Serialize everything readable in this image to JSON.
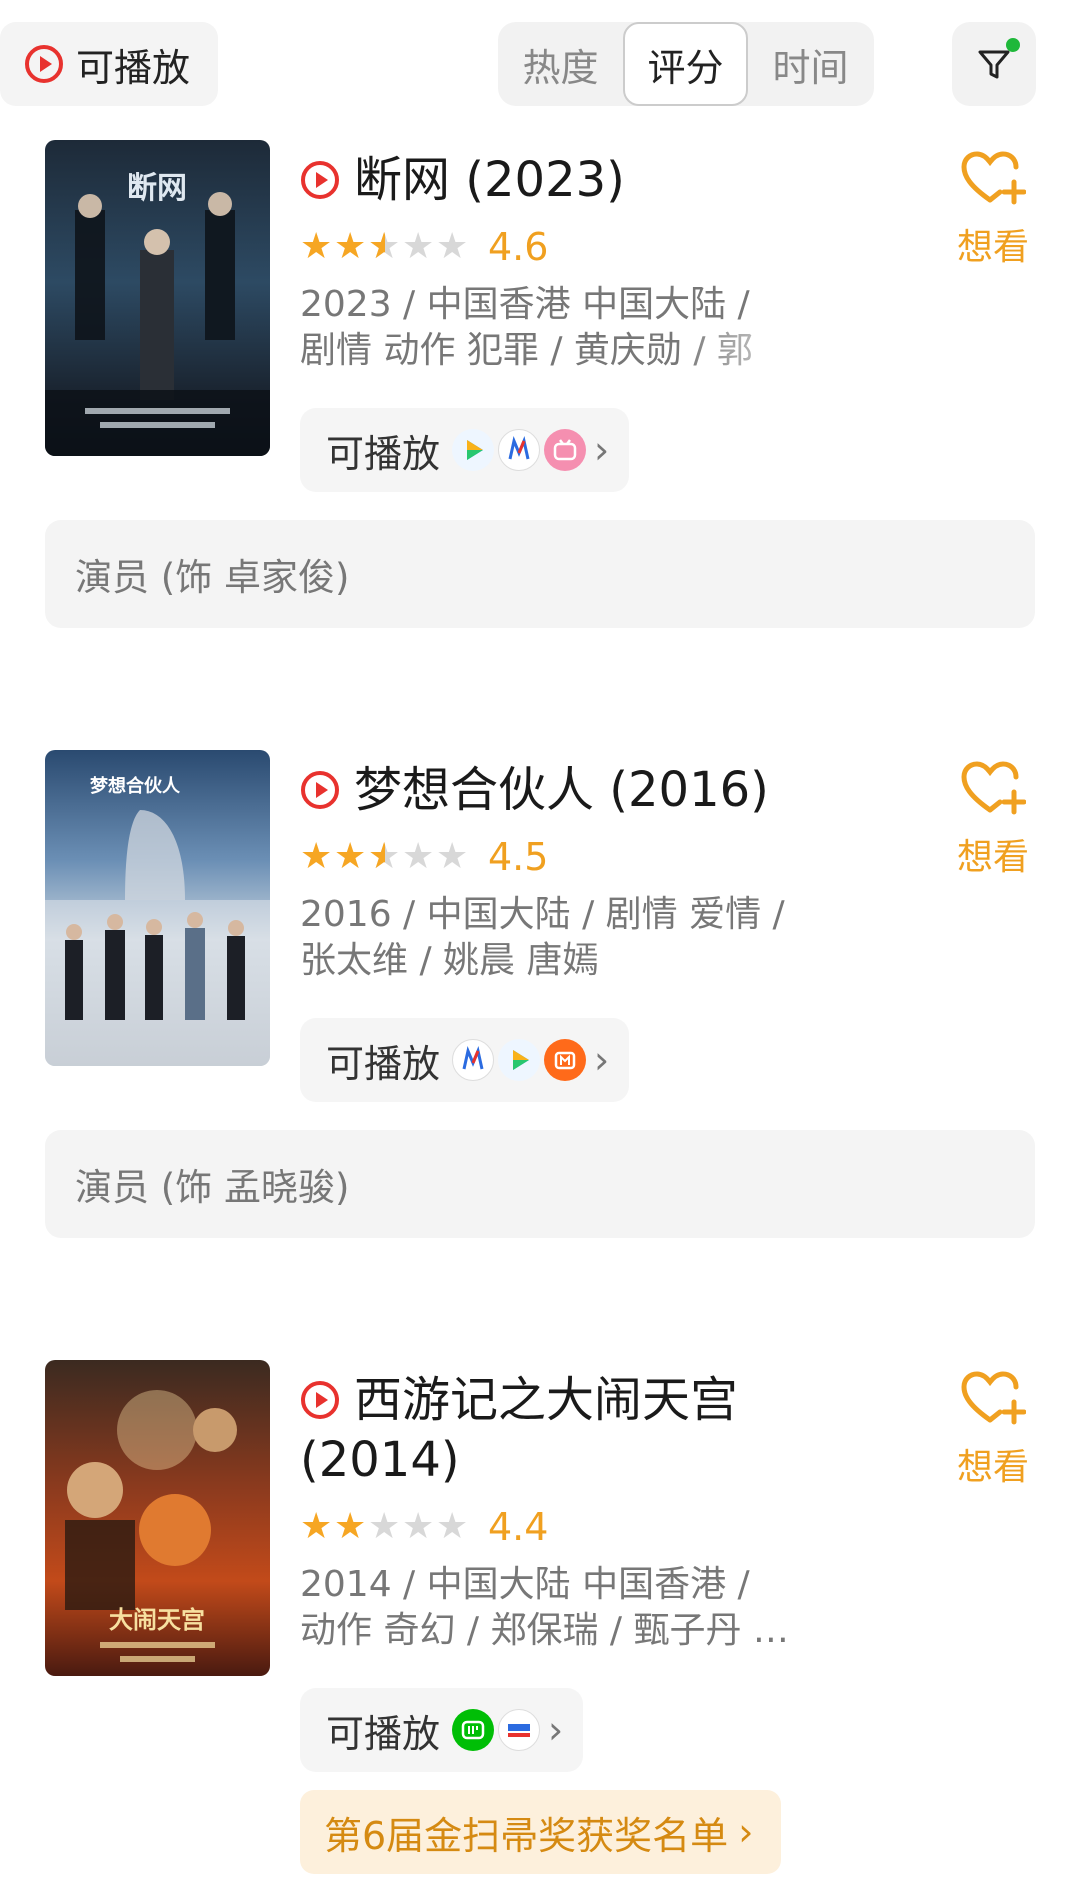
{
  "topbar": {
    "play_toggle_label": "可播放",
    "sort_tabs": [
      "热度",
      "评分",
      "时间"
    ],
    "active_sort": "评分",
    "filter_active": true
  },
  "colors": {
    "accent": "#f0a020",
    "play_red": "#e8322e",
    "filter_dot": "#1fb83a"
  },
  "movies": [
    {
      "title": "断网 (2023)",
      "rating": "4.6",
      "stars": 2.5,
      "meta_line1": "2023 / 中国香港 中国大陆 /",
      "meta_line2": "剧情 动作 犯罪 / 黄庆勋 / 郭",
      "play_label": "可播放",
      "services": [
        "tencent-video",
        "migu-video",
        "bilibili"
      ],
      "want_label": "想看",
      "role": "演员 (饰 卓家俊)"
    },
    {
      "title": "梦想合伙人 (2016)",
      "rating": "4.5",
      "stars": 2.5,
      "meta_line1": "2016 / 中国大陆 / 剧情 爱情 /",
      "meta_line2": "张太维 / 姚晨 唐嫣",
      "play_label": "可播放",
      "services": [
        "migu-video",
        "tencent-video",
        "mango-tv"
      ],
      "want_label": "想看",
      "role": "演员 (饰 孟晓骏)"
    },
    {
      "title_line1": "西游记之大闹天宫",
      "title_line2": "(2014)",
      "rating": "4.4",
      "stars": 2,
      "meta_line1": "2014 / 中国大陆 中国香港 /",
      "meta_line2": "动作 奇幻 / 郑保瑞 / 甄子丹 …",
      "play_label": "可播放",
      "services": [
        "iqiyi",
        "1905-movie"
      ],
      "want_label": "想看",
      "award": "第6届金扫帚奖获奖名单"
    }
  ]
}
